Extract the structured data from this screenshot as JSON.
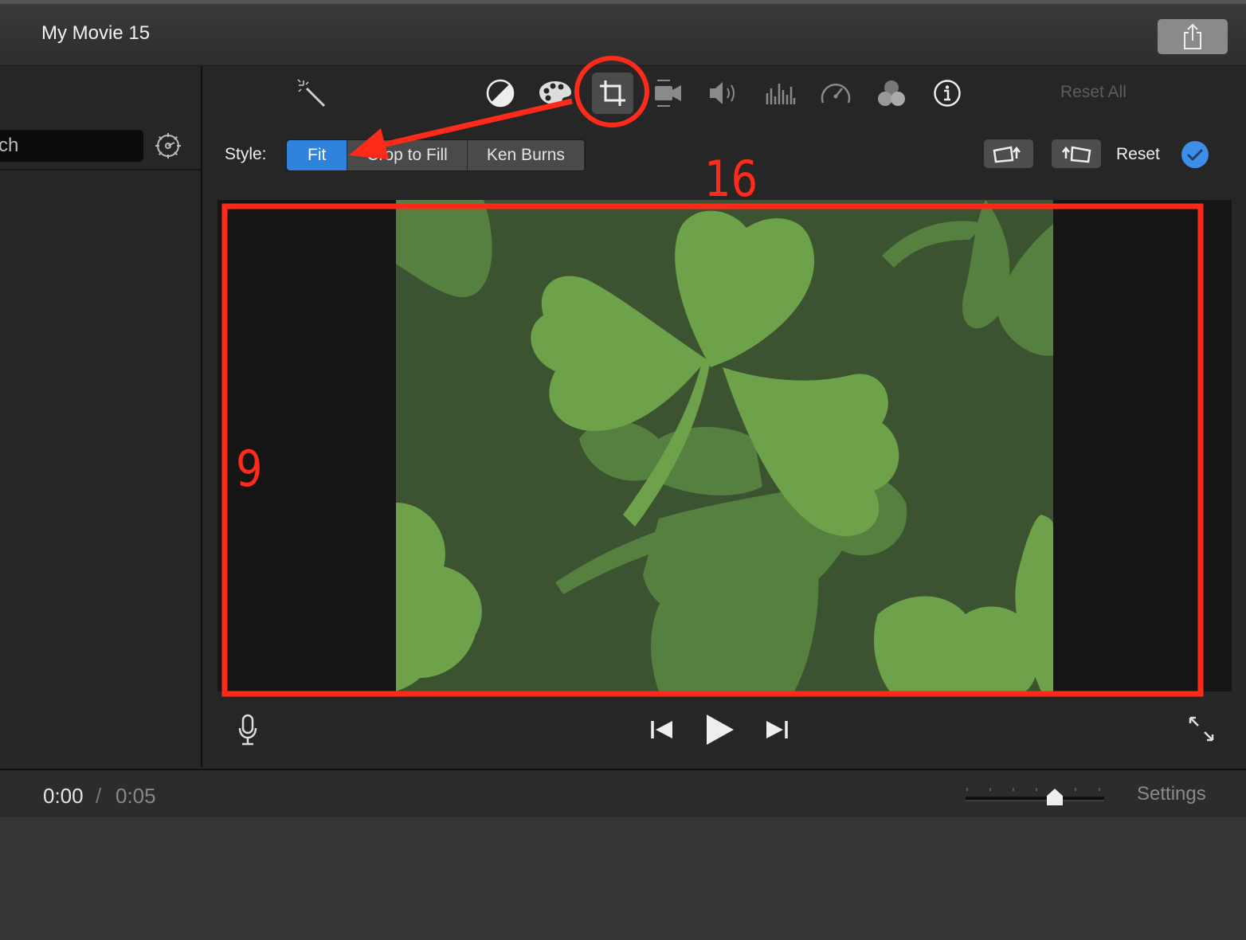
{
  "window": {
    "title": "My Movie 15",
    "share_icon": "share-icon"
  },
  "sidebar": {
    "search_visible_text": "ch",
    "gear_icon": "gear-icon"
  },
  "toolbar": {
    "tools": [
      "magic-wand-icon",
      "color-balance-icon",
      "color-correction-icon",
      "crop-icon",
      "stabilization-icon",
      "volume-icon",
      "noise-reduction-icon",
      "speed-icon",
      "clip-filter-icon",
      "info-icon"
    ],
    "active_tool": "crop-icon",
    "reset_all_label": "Reset All"
  },
  "crop": {
    "style_label": "Style:",
    "styles": [
      "Fit",
      "Crop to Fill",
      "Ken Burns"
    ],
    "selected_style": "Fit",
    "reset_label": "Reset"
  },
  "annotations": {
    "width_label": "16",
    "height_label": "9",
    "color": "#ff2a1a"
  },
  "playback": {
    "current_time": "0:00",
    "separator": "/",
    "duration": "0:05"
  },
  "timeline": {
    "settings_label": "Settings"
  },
  "colors": {
    "accent": "#2f83dc",
    "annotation_red": "#ff2a1a",
    "clip_dark_green": "#3b5330",
    "clip_light_green": "#6ea24a"
  }
}
